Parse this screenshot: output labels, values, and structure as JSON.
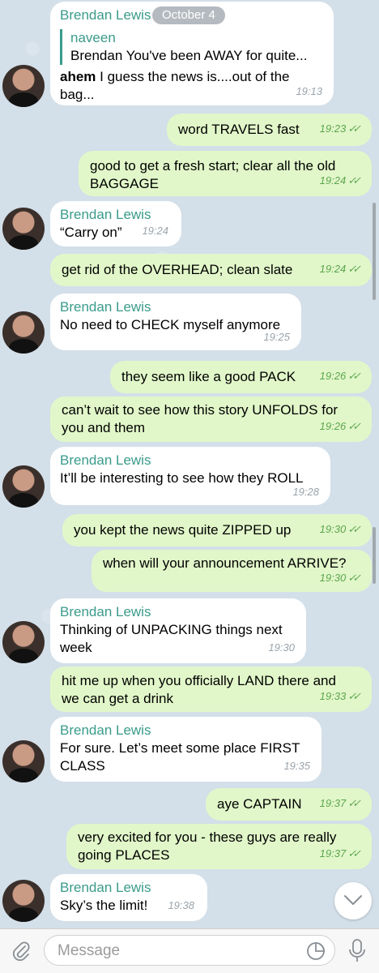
{
  "date_pill": "October 4",
  "contact": "Brendan Lewis",
  "first": {
    "quote_name": "naveen",
    "quote_text": "Brendan You've been AWAY for quite...",
    "bold": "ahem",
    "text_a": " I guess the news is....out of the",
    "text_b": "bag...",
    "time": "19:13"
  },
  "messages": [
    {
      "id": "m1",
      "line1": "word TRAVELS fast",
      "line2": "",
      "time": "19:23"
    },
    {
      "id": "m2",
      "line1": "good to get a fresh start; clear all the old",
      "line2": "BAGGAGE",
      "time": "19:24"
    },
    {
      "id": "m3",
      "line1": "“Carry on”",
      "line2": "",
      "time": "19:24"
    },
    {
      "id": "m4",
      "line1": "get rid of the OVERHEAD; clean slate",
      "line2": "",
      "time": "19:24"
    },
    {
      "id": "m5",
      "line1": "No need to CHECK myself anymore",
      "line2": "",
      "time": "19:25"
    },
    {
      "id": "m6",
      "line1": "they seem like a good PACK",
      "line2": "",
      "time": "19:26"
    },
    {
      "id": "m7",
      "line1": "can’t wait to see how this story UNFOLDS for",
      "line2": "you and them",
      "time": "19:26"
    },
    {
      "id": "m8",
      "line1": "It’ll be interesting to see how they ROLL",
      "line2": "",
      "time": "19:28"
    },
    {
      "id": "m9",
      "line1": "you kept the news quite ZIPPED up",
      "line2": "",
      "time": "19:30"
    },
    {
      "id": "m10",
      "line1": "when will your announcement ARRIVE?",
      "line2": "",
      "time": "19:30"
    },
    {
      "id": "m11",
      "line1": "Thinking of UNPACKING things next",
      "line2": "week",
      "time": "19:30"
    },
    {
      "id": "m12",
      "line1": "hit me up when you officially LAND there and",
      "line2": "we can get a drink",
      "time": "19:33"
    },
    {
      "id": "m13",
      "line1": "For sure. Let’s meet some place FIRST",
      "line2": "CLASS",
      "time": "19:35"
    },
    {
      "id": "m14",
      "line1": "aye CAPTAIN",
      "line2": "",
      "time": "19:37"
    },
    {
      "id": "m15",
      "line1": "very excited for you - these guys are really",
      "line2": "going PLACES",
      "time": "19:37"
    },
    {
      "id": "m16",
      "line1": "Sky’s the limit!",
      "line2": "",
      "time": "19:38"
    }
  ],
  "input": {
    "placeholder": "Message",
    "value": ""
  },
  "icons": {
    "attach": "paperclip-icon",
    "sticker": "sticker-icon",
    "mic": "microphone-icon",
    "scroll_down": "chevron-down-icon"
  }
}
